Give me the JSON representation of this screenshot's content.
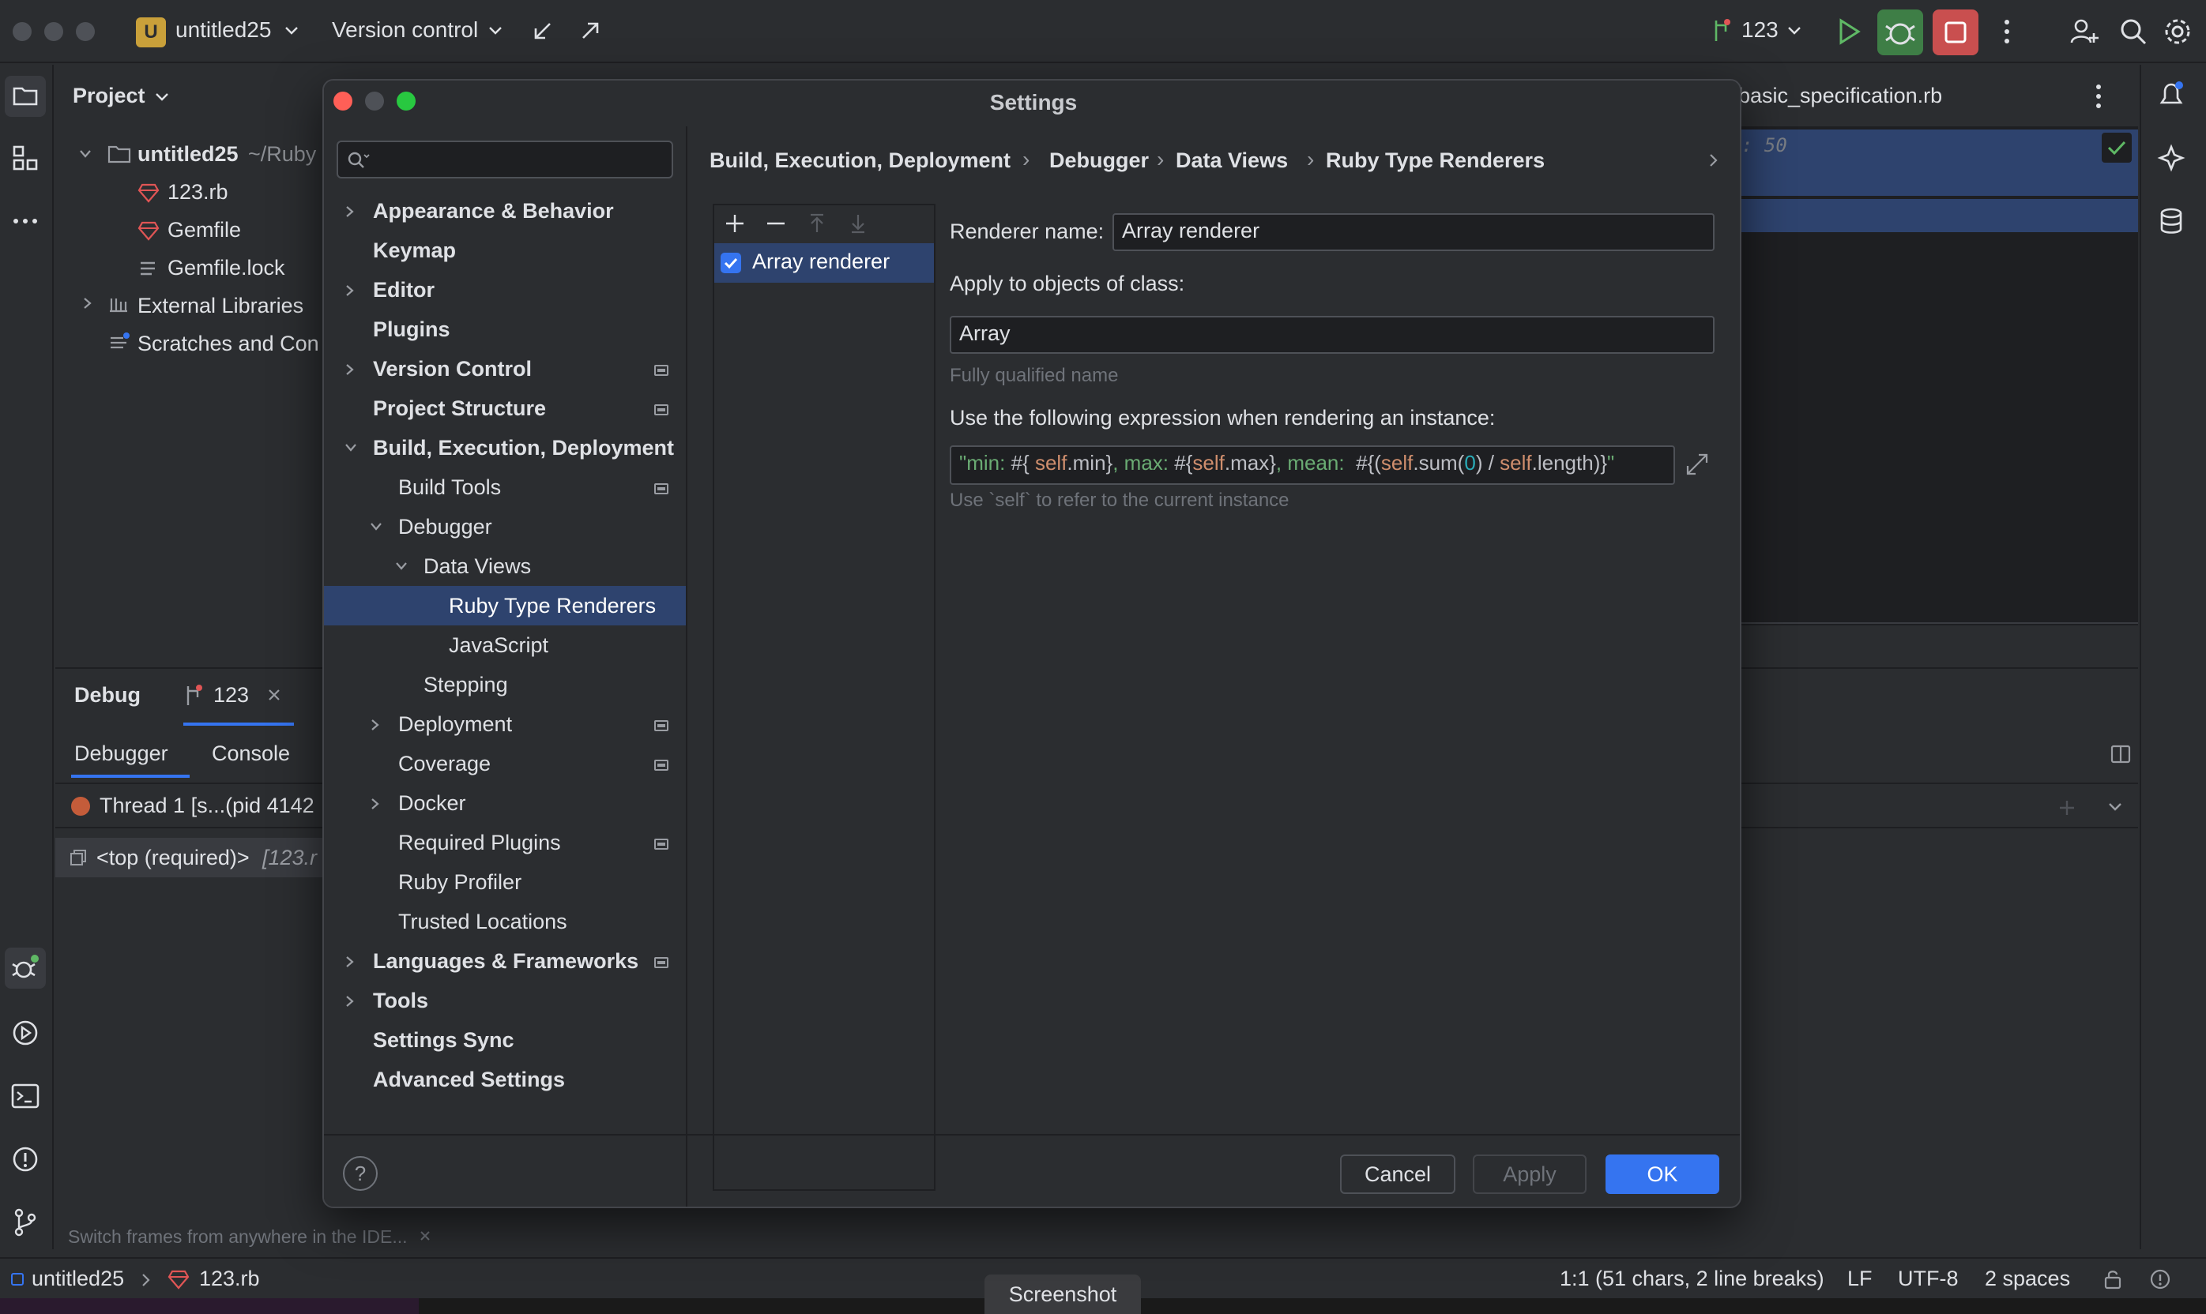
{
  "titlebar": {
    "project_initial": "U",
    "project_name": "untitled25",
    "vcs_label": "Version control",
    "run_config": "123"
  },
  "project_panel": {
    "title": "Project",
    "root_name": "untitled25",
    "root_path": "~/Ruby",
    "files": [
      "123.rb",
      "Gemfile",
      "Gemfile.lock"
    ],
    "external_libraries": "External Libraries",
    "scratches": "Scratches and Con"
  },
  "editor": {
    "tab_name": "basic_specification.rb",
    "inlay_hint": ": 50"
  },
  "debug_panel": {
    "title": "Debug",
    "session_name": "123",
    "tabs": [
      "Debugger",
      "Console"
    ],
    "thread": "Thread 1 [s...(pid 4142",
    "frame": "<top (required)>",
    "frame_file": "[123.r",
    "tip": "Switch frames from anywhere in the IDE..."
  },
  "statusbar": {
    "project": "untitled25",
    "file": "123.rb",
    "position": "1:1 (51 chars, 2 line breaks)",
    "line_sep": "LF",
    "encoding": "UTF-8",
    "indent": "2 spaces",
    "screenshot_label": "Screenshot"
  },
  "dialog": {
    "title": "Settings",
    "search_placeholder": "",
    "tree": [
      {
        "label": "Appearance & Behavior",
        "level": 0,
        "bold": true,
        "chevron": "right",
        "badge": false
      },
      {
        "label": "Keymap",
        "level": 0,
        "bold": true,
        "chevron": "none",
        "badge": false
      },
      {
        "label": "Editor",
        "level": 0,
        "bold": true,
        "chevron": "right",
        "badge": false
      },
      {
        "label": "Plugins",
        "level": 0,
        "bold": true,
        "chevron": "none",
        "badge": false
      },
      {
        "label": "Version Control",
        "level": 0,
        "bold": true,
        "chevron": "right",
        "badge": true
      },
      {
        "label": "Project Structure",
        "level": 0,
        "bold": true,
        "chevron": "none",
        "badge": true
      },
      {
        "label": "Build, Execution, Deployment",
        "level": 0,
        "bold": true,
        "chevron": "down",
        "badge": false
      },
      {
        "label": "Build Tools",
        "level": 1,
        "bold": false,
        "chevron": "none",
        "badge": true
      },
      {
        "label": "Debugger",
        "level": 1,
        "bold": false,
        "chevron": "down",
        "badge": false
      },
      {
        "label": "Data Views",
        "level": 2,
        "bold": false,
        "chevron": "down",
        "badge": false
      },
      {
        "label": "Ruby Type Renderers",
        "level": 3,
        "bold": false,
        "chevron": "none",
        "badge": false,
        "selected": true
      },
      {
        "label": "JavaScript",
        "level": 3,
        "bold": false,
        "chevron": "none",
        "badge": false
      },
      {
        "label": "Stepping",
        "level": 2,
        "bold": false,
        "chevron": "none",
        "badge": false
      },
      {
        "label": "Deployment",
        "level": 1,
        "bold": false,
        "chevron": "right",
        "badge": true
      },
      {
        "label": "Coverage",
        "level": 1,
        "bold": false,
        "chevron": "none",
        "badge": true
      },
      {
        "label": "Docker",
        "level": 1,
        "bold": false,
        "chevron": "right",
        "badge": false
      },
      {
        "label": "Required Plugins",
        "level": 1,
        "bold": false,
        "chevron": "none",
        "badge": true
      },
      {
        "label": "Ruby Profiler",
        "level": 1,
        "bold": false,
        "chevron": "none",
        "badge": false
      },
      {
        "label": "Trusted Locations",
        "level": 1,
        "bold": false,
        "chevron": "none",
        "badge": false
      },
      {
        "label": "Languages & Frameworks",
        "level": 0,
        "bold": true,
        "chevron": "right",
        "badge": true
      },
      {
        "label": "Tools",
        "level": 0,
        "bold": true,
        "chevron": "right",
        "badge": false
      },
      {
        "label": "Settings Sync",
        "level": 0,
        "bold": true,
        "chevron": "none",
        "badge": false
      },
      {
        "label": "Advanced Settings",
        "level": 0,
        "bold": true,
        "chevron": "none",
        "badge": false
      }
    ],
    "breadcrumb": [
      "Build, Execution, Deployment",
      "Debugger",
      "Data Views",
      "Ruby Type Renderers"
    ],
    "renderers": [
      {
        "name": "Array renderer",
        "enabled": true
      }
    ],
    "form": {
      "renderer_name_label": "Renderer name:",
      "renderer_name_value": "Array renderer",
      "apply_class_label": "Apply to objects of class:",
      "apply_class_value": "Array",
      "apply_class_hint": "Fully qualified name",
      "expression_label": "Use the following expression when rendering an instance:",
      "expression_hint": "Use `self` to refer to the current instance",
      "expression_tokens": [
        {
          "t": "\"min: ",
          "c": "str"
        },
        {
          "t": "#{ ",
          "c": "plain"
        },
        {
          "t": "self",
          "c": "self"
        },
        {
          "t": ".min}",
          "c": "plain"
        },
        {
          "t": ", max: ",
          "c": "str"
        },
        {
          "t": "#{",
          "c": "plain"
        },
        {
          "t": "self",
          "c": "self"
        },
        {
          "t": ".max}",
          "c": "plain"
        },
        {
          "t": ", mean:  ",
          "c": "str"
        },
        {
          "t": "#{(",
          "c": "plain"
        },
        {
          "t": "self",
          "c": "self"
        },
        {
          "t": ".sum(",
          "c": "plain"
        },
        {
          "t": "0",
          "c": "num"
        },
        {
          "t": ") / ",
          "c": "plain"
        },
        {
          "t": "self",
          "c": "self"
        },
        {
          "t": ".length)}",
          "c": "plain"
        },
        {
          "t": "\"",
          "c": "str"
        }
      ]
    },
    "buttons": {
      "cancel": "Cancel",
      "apply": "Apply",
      "ok": "OK",
      "help": "?"
    }
  },
  "colors": {
    "accent": "#3574f0",
    "selection": "#2e436e",
    "run_green": "#5fb865",
    "stop_red": "#db5c5c",
    "ruby_red": "#e05555"
  }
}
